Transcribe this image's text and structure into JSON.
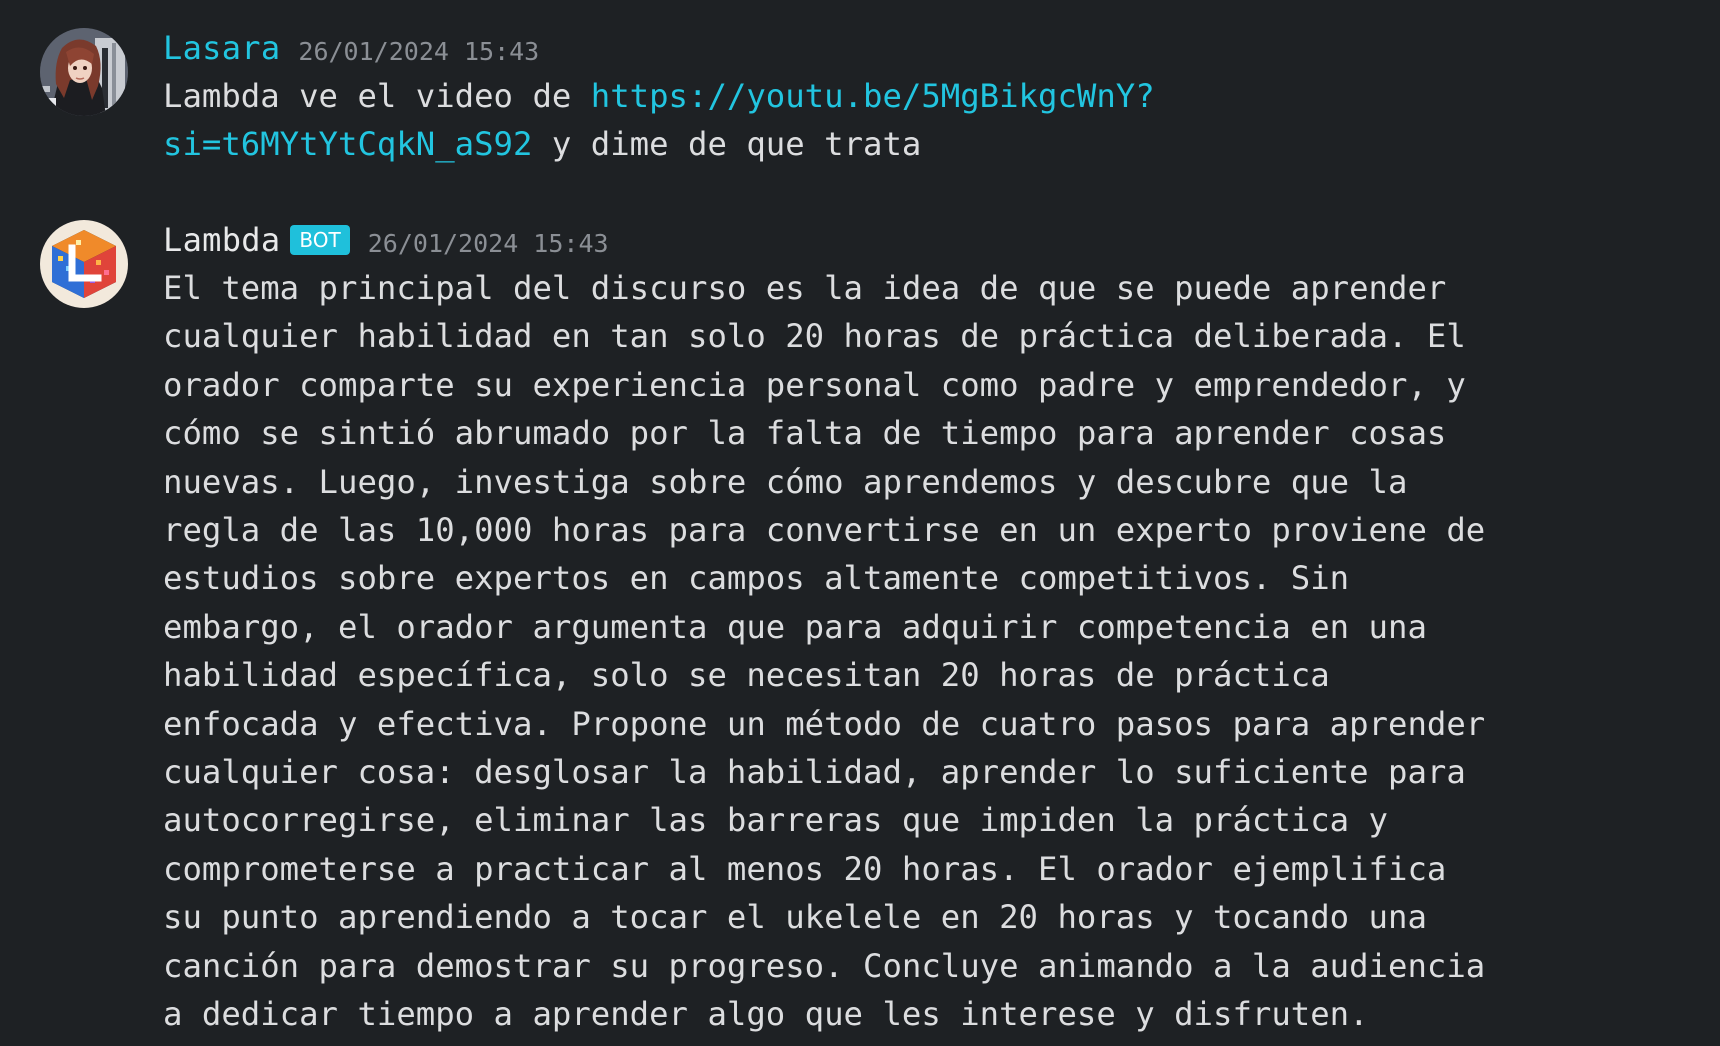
{
  "messages": [
    {
      "author": "Lasara",
      "timestamp": "26/01/2024 15:43",
      "avatar_icon": "anime-character-avatar-icon",
      "text_before": "Lambda ve el video de ",
      "link_part1": "https://youtu.be/5MgBikgcWnY?",
      "link_part2": "si=t6MYtYtCqkN_aS92",
      "text_after": " y dime de que trata"
    },
    {
      "author": "Lambda",
      "badge": "BOT",
      "timestamp": "26/01/2024 15:43",
      "avatar_icon": "lambda-cube-logo-icon",
      "lines": [
        "El tema principal del discurso es la idea de que se puede aprender",
        "cualquier habilidad en tan solo 20 horas de práctica deliberada. El",
        "orador comparte su experiencia personal como padre y emprendedor, y",
        "cómo se sintió abrumado por la falta de tiempo para aprender cosas",
        "nuevas. Luego, investiga sobre cómo aprendemos y descubre que la",
        "regla de las 10,000 horas para convertirse en un experto proviene de",
        "estudios sobre expertos en campos altamente competitivos. Sin",
        "embargo, el orador argumenta que para adquirir competencia en una",
        "habilidad específica, solo se necesitan 20 horas de práctica",
        "enfocada y efectiva. Propone un método de cuatro pasos para aprender",
        "cualquier cosa: desglosar la habilidad, aprender lo suficiente para",
        "autocorregirse, eliminar las barreras que impiden la práctica y",
        "comprometerse a practicar al menos 20 horas. El orador ejemplifica",
        "su punto aprendiendo a tocar el ukelele en 20 horas y tocando una",
        "canción para demostrar su progreso. Concluye animando a la audiencia",
        "a dedicar tiempo a aprender algo que les interese y disfruten."
      ]
    }
  ],
  "colors": {
    "background": "#1e2124",
    "link": "#22c5e0",
    "bot_badge": "#1fc0db",
    "timestamp": "#8b8f95",
    "text": "#dcdddf"
  }
}
